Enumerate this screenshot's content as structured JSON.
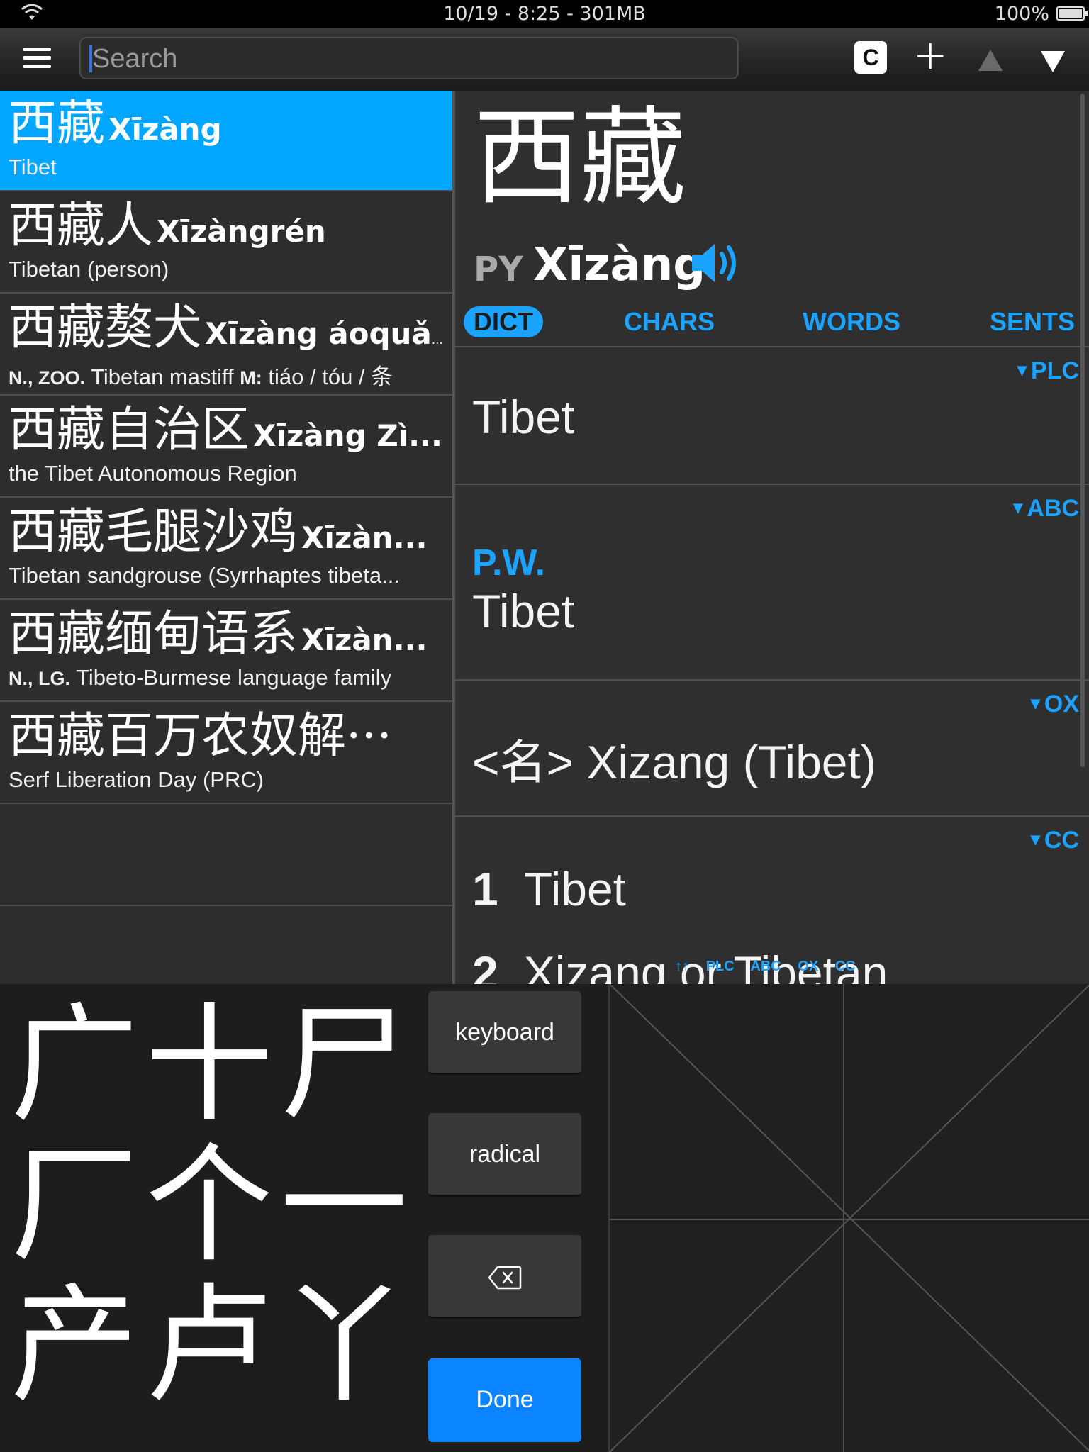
{
  "status": {
    "time_mem": "10/19 - 8:25 - 301MB",
    "battery": "100%"
  },
  "toolbar": {
    "search_placeholder": "Search",
    "clipboard_label": "C",
    "add_label": "+"
  },
  "results": [
    {
      "hanzi": "西藏",
      "pinyin": "Xīzàng",
      "pos": "",
      "def": "Tibet"
    },
    {
      "hanzi": "西藏人",
      "pinyin": "Xīzàngrén",
      "pos": "",
      "def": "Tibetan (person)"
    },
    {
      "hanzi": "西藏獒犬",
      "pinyin": "Xīzàng áoquǎn",
      "pos": "N., ZOO.",
      "def": "Tibetan mastiff",
      "measure_label": "M:",
      "measure": "tiáo / tóu / 条"
    },
    {
      "hanzi": "西藏自治区",
      "pinyin": "Xīzàng Zì...",
      "pos": "",
      "def": "the Tibet Autonomous Region"
    },
    {
      "hanzi": "西藏毛腿沙鸡",
      "pinyin": "Xīzàn...",
      "pos": "",
      "def": "Tibetan sandgrouse (Syrrhaptes tibeta..."
    },
    {
      "hanzi": "西藏缅甸语系",
      "pinyin": "Xīzàn...",
      "pos": "N., LG.",
      "def": "Tibeto-Burmese language family"
    },
    {
      "hanzi": "西藏百万农奴解···",
      "pinyin": "",
      "pos": "",
      "def": "Serf Liberation Day (PRC)"
    }
  ],
  "detail": {
    "hanzi": "西藏",
    "py_label": "PY",
    "pinyin": "Xīzàng",
    "tabs": [
      "DICT",
      "CHARS",
      "WORDS",
      "SENTS"
    ],
    "plc": {
      "tag": "PLC",
      "def": "Tibet"
    },
    "abc": {
      "tag": "ABC",
      "abbr": "P.W.",
      "def": "Tibet"
    },
    "ox": {
      "tag": "OX",
      "def": "<名> Xizang (Tibet)"
    },
    "cc": {
      "tag": "CC",
      "defs": [
        {
          "num": "1",
          "text": "Tibet"
        },
        {
          "num": "2",
          "text": "Xizang or Tibetan"
        }
      ]
    },
    "jump": [
      "↑↑",
      "PLC",
      "ABC",
      "OX",
      "CC"
    ]
  },
  "handwriting": {
    "candidates": [
      "广",
      "十",
      "尸",
      "厂",
      "个",
      "一",
      "产",
      "卢",
      "丫"
    ],
    "keyboard_label": "keyboard",
    "radical_label": "radical",
    "done_label": "Done"
  }
}
